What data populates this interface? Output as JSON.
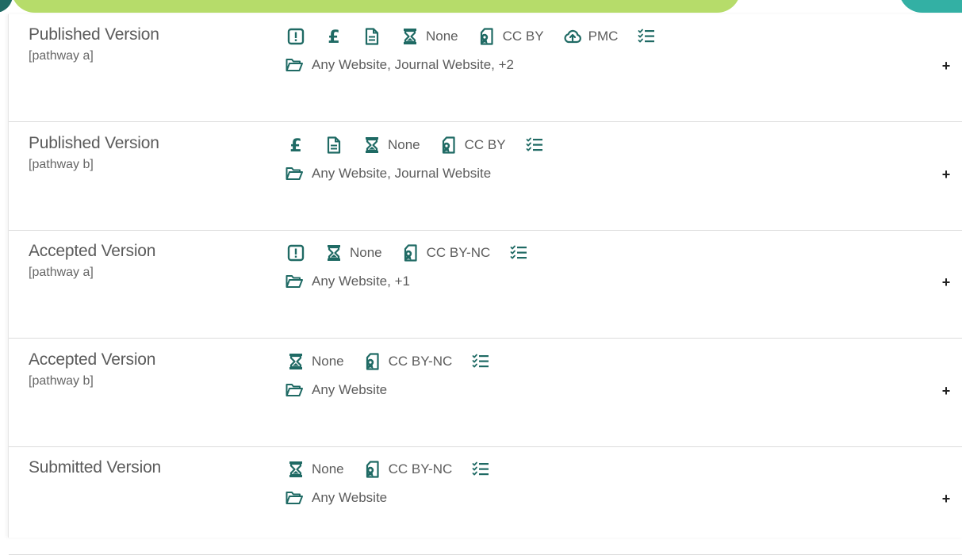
{
  "rows": [
    {
      "version": "Published Version",
      "pathway": "[pathway a]",
      "icons": [
        {
          "icon": "exclamation-box-icon"
        },
        {
          "icon": "pound-icon"
        },
        {
          "icon": "document-icon"
        },
        {
          "icon": "hourglass-icon",
          "text": "None"
        },
        {
          "icon": "license-icon",
          "text": "CC BY"
        },
        {
          "icon": "cloud-upload-icon",
          "text": "PMC"
        },
        {
          "icon": "checklist-icon"
        }
      ],
      "locations": "Any Website, Journal Website, +2",
      "expand": "+"
    },
    {
      "version": "Published Version",
      "pathway": "[pathway b]",
      "icons": [
        {
          "icon": "pound-icon"
        },
        {
          "icon": "document-icon"
        },
        {
          "icon": "hourglass-icon",
          "text": "None"
        },
        {
          "icon": "license-icon",
          "text": "CC BY"
        },
        {
          "icon": "checklist-icon"
        }
      ],
      "locations": "Any Website, Journal Website",
      "expand": "+"
    },
    {
      "version": "Accepted Version",
      "pathway": "[pathway a]",
      "icons": [
        {
          "icon": "exclamation-box-icon"
        },
        {
          "icon": "hourglass-icon",
          "text": "None"
        },
        {
          "icon": "license-icon",
          "text": "CC BY-NC"
        },
        {
          "icon": "checklist-icon"
        }
      ],
      "locations": "Any Website, +1",
      "expand": "+"
    },
    {
      "version": "Accepted Version",
      "pathway": "[pathway b]",
      "icons": [
        {
          "icon": "hourglass-icon",
          "text": "None"
        },
        {
          "icon": "license-icon",
          "text": "CC BY-NC"
        },
        {
          "icon": "checklist-icon"
        }
      ],
      "locations": "Any Website",
      "expand": "+"
    },
    {
      "version": "Submitted Version",
      "pathway": "",
      "icons": [
        {
          "icon": "hourglass-icon",
          "text": "None"
        },
        {
          "icon": "license-icon",
          "text": "CC BY-NC"
        },
        {
          "icon": "checklist-icon"
        }
      ],
      "locations": "Any Website",
      "expand": "+"
    }
  ],
  "colors": {
    "icon": "#1f6a64",
    "band_green": "#b6dc6a",
    "band_teal": "#33b0a4"
  }
}
